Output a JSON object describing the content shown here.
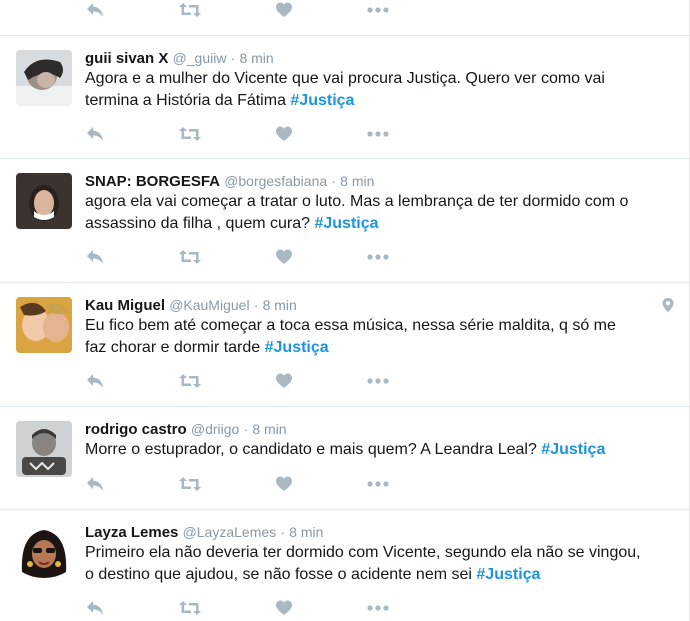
{
  "tweets": [
    {
      "name": "guii sivan",
      "badge": "X",
      "handle": "@_guiiw",
      "sep": "·",
      "time": "8 min",
      "text": "Agora e a mulher do Vicente que vai procura Justiça. Quero ver como vai\ntermina a História da Fátima ",
      "hashtag": "#Justiça"
    },
    {
      "name": "SNAP: BORGESFA",
      "handle": "@borgesfabiana",
      "sep": "·",
      "time": "8 min",
      "text": "agora ela vai começar a tratar o luto. Mas a lembrança de ter dormido com o\nassassino da filha , quem cura? ",
      "hashtag": "#Justiça"
    },
    {
      "name": "Kau Miguel",
      "handle": "@KauMiguel",
      "sep": "·",
      "time": "8 min",
      "text": "Eu fico bem até começar a toca essa música, nessa série maldita, q só me\nfaz chorar e dormir tarde ",
      "hashtag": "#Justiça"
    },
    {
      "name": "rodrigo castro",
      "handle": "@driigo",
      "sep": "·",
      "time": "8 min",
      "text": "Morre o estuprador, o candidato e mais quem? A Leandra Leal? ",
      "hashtag": "#Justiça"
    },
    {
      "name": "Layza Lemes",
      "handle": "@LayzaLemes",
      "sep": "·",
      "time": "8 min",
      "text": "Primeiro ela não deveria ter dormido com Vicente, segundo ela não se vingou,\no destino que ajudou, se não fosse o acidente nem sei ",
      "hashtag": "#Justiça"
    }
  ],
  "icons": {
    "reply": "reply-icon",
    "retweet": "retweet-icon",
    "like": "heart-icon",
    "more": "more-icon",
    "geo": "location-pin-icon"
  },
  "colors": {
    "action_gray": "#aab8c2",
    "hashtag_blue": "#1b95e0",
    "meta_gray": "#8899a6"
  }
}
